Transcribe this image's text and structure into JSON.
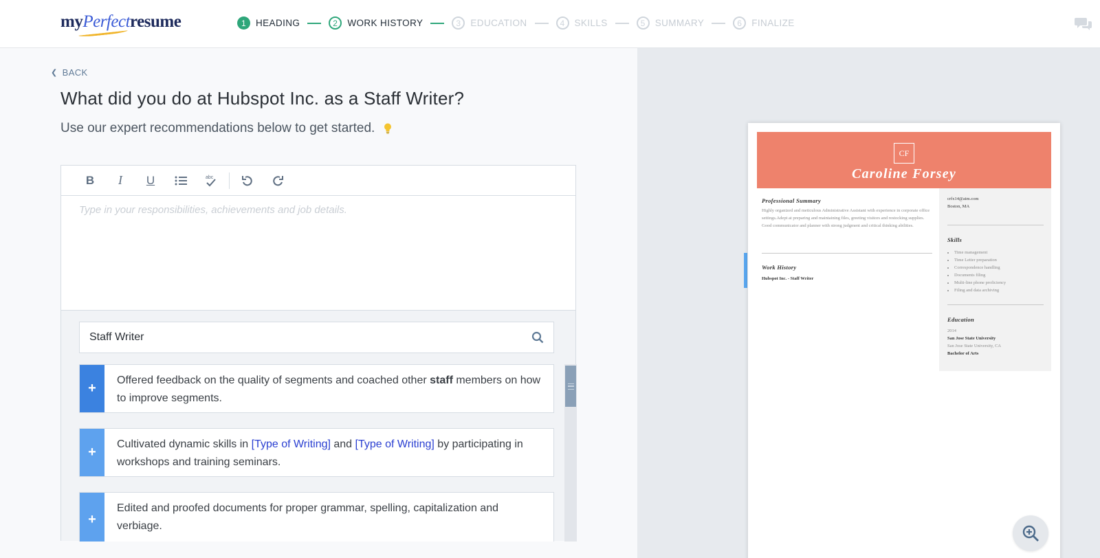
{
  "brand": {
    "logo_my": "my",
    "logo_perfect": "Perfect",
    "logo_resume": "resume"
  },
  "steps": [
    {
      "num": "1",
      "label": "HEADING",
      "state": "done"
    },
    {
      "num": "2",
      "label": "WORK HISTORY",
      "state": "current"
    },
    {
      "num": "3",
      "label": "EDUCATION",
      "state": "todo"
    },
    {
      "num": "4",
      "label": "SKILLS",
      "state": "todo"
    },
    {
      "num": "5",
      "label": "SUMMARY",
      "state": "todo"
    },
    {
      "num": "6",
      "label": "FINALIZE",
      "state": "todo"
    }
  ],
  "main": {
    "back_label": "BACK",
    "question": "What did you do at Hubspot Inc. as a Staff Writer?",
    "subline": "Use our expert recommendations below to get started."
  },
  "editor": {
    "toolbar": {
      "bold": "B",
      "italic": "I",
      "underline": "U",
      "spell": "abc"
    },
    "placeholder": "Type in your responsibilities, achievements and job details."
  },
  "search": {
    "value": "Staff Writer"
  },
  "recommendations": [
    {
      "pre": "Offered feedback on the quality of segments and coached other ",
      "bold": "staff",
      "post": " members on how to improve segments."
    },
    {
      "pre": "Cultivated dynamic skills in ",
      "ph1": "[Type of Writing]",
      "mid": " and ",
      "ph2": "[Type of Writing]",
      "post": " by participating in workshops and training seminars."
    },
    {
      "text": "Edited and proofed documents for proper grammar, spelling, capitalization and verbiage."
    }
  ],
  "preview": {
    "monogram": "CF",
    "name": "Caroline Forsey",
    "summary_heading": "Professional Summary",
    "summary_text": "Highly organized and meticulous Administrative Assistant with experience in corporate office settings.Adept at preparing and maintaining files, greeting visitors and restocking supplies. Good communicator and planner with strong judgment and critical thinking abilities.",
    "work_heading": "Work History",
    "work_entry": "Hubspot Inc. - Staff Writer",
    "email": "crfx14@aim.com",
    "location": "Boston, MA",
    "skills_heading": "Skills",
    "skills": [
      "Time management",
      "Time Letter preparation",
      "Correspondence handling",
      "Documents filing",
      "Multi-line phone proficiency",
      "Filing and data archiving"
    ],
    "education_heading": "Education",
    "edu_year": "2014",
    "edu_school": "San Jose State University",
    "edu_location": "San Jose State University, CA",
    "edu_degree": "Bachelor of Arts"
  },
  "colors": {
    "accent_green": "#2ea67a",
    "plus_blue": "#3b82e0",
    "banner": "#ee826c"
  }
}
